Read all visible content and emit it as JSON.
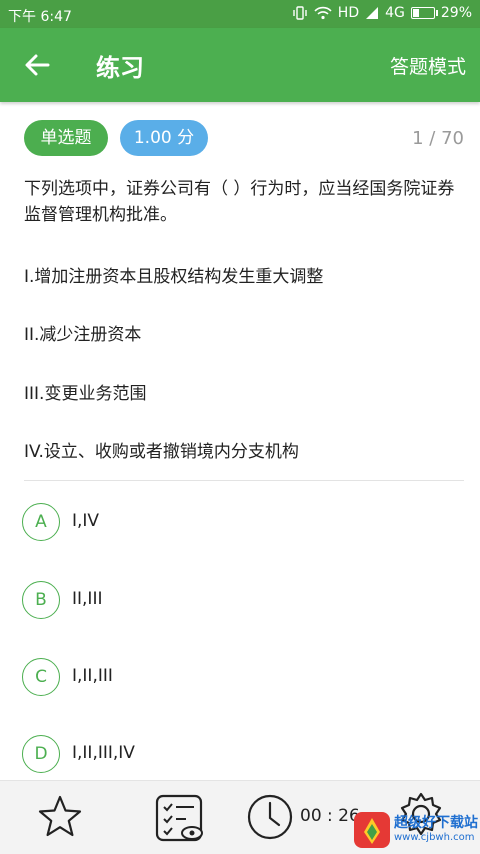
{
  "status_bar": {
    "time": "下午 6:47",
    "network": "HD",
    "signal_type": "4G",
    "battery": "29%",
    "battery_level": 0.29
  },
  "app_bar": {
    "title": "练习",
    "mode_label": "答题模式"
  },
  "question": {
    "type_tag": "单选题",
    "score_tag": "1.00 分",
    "progress": "1 / 70",
    "text": "下列选项中，证券公司有（ ）行为时，应当经国务院证券监督管理机构批准。",
    "statements": [
      "I.增加注册资本且股权结构发生重大调整",
      "II.减少注册资本",
      "III.变更业务范围",
      "IV.设立、收购或者撤销境内分支机构"
    ],
    "options": [
      {
        "letter": "A",
        "text": "I,IV"
      },
      {
        "letter": "B",
        "text": "II,III"
      },
      {
        "letter": "C",
        "text": "I,II,III"
      },
      {
        "letter": "D",
        "text": "I,II,III,IV"
      }
    ]
  },
  "bottom_bar": {
    "timer": "00 : 26"
  },
  "watermark": {
    "line1": "超级好下载站",
    "line2": "www.cjbwh.com"
  },
  "colors": {
    "status_bar": "#4a9f45",
    "app_bar": "#4caf50",
    "type_tag": "#4cae4f",
    "score_tag": "#5aaee8",
    "option_accent": "#4caf50"
  }
}
